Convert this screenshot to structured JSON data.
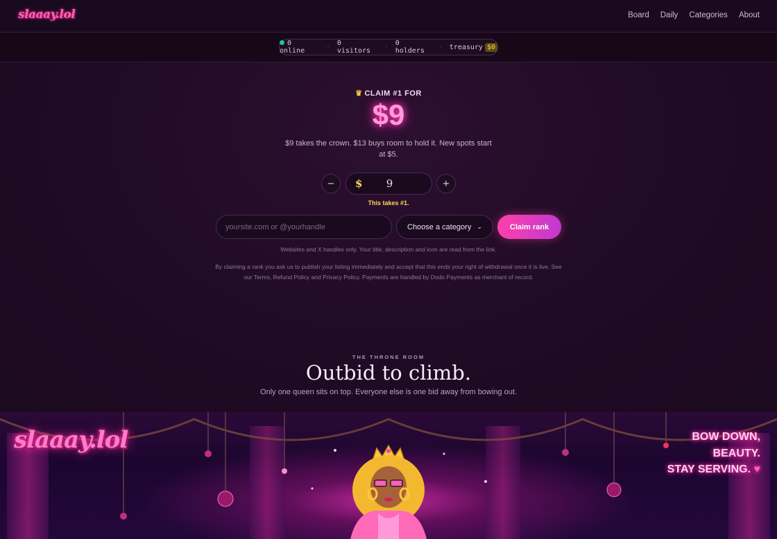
{
  "header": {
    "logo_text": "slaaay.lol",
    "nav": [
      {
        "label": "Board"
      },
      {
        "label": "Daily"
      },
      {
        "label": "Categories"
      },
      {
        "label": "About"
      }
    ]
  },
  "stats": {
    "online": "0 online",
    "visitors": "0 visitors",
    "holders": "0 holders",
    "treasury_label": "treasury",
    "treasury_value": "$0",
    "separator": "·"
  },
  "claim": {
    "label": "CLAIM #1 FOR",
    "crown_glyph": "♛",
    "price": "$9",
    "description": "$9 takes the crown. $13 buys room to hold it. New spots start at $5.",
    "minus_label": "−",
    "plus_label": "+",
    "currency": "$",
    "amount": "9",
    "takes_text": "This takes #1.",
    "url_placeholder": "yoursite.com or @yourhandle",
    "category_value": "Choose a category",
    "chevron_glyph": "⌄",
    "claim_button": "Claim rank",
    "fine_print": "Websites and X handles only. Your title, description and icon are read from the link.",
    "legal": "By claiming a rank you ask us to publish your listing immediately and accept that this ends your right of withdrawal once it is live. See our Terms, Refund Policy and Privacy Policy. Payments are handled by Dodo Payments as merchant of record."
  },
  "throne": {
    "kicker": "THE THRONE ROOM",
    "title": "Outbid to climb.",
    "subtitle": "Only one queen sits on top. Everyone else is one bid away from bowing out.",
    "scene_logo": "slaaay.lol",
    "tagline": [
      "BOW DOWN,",
      "BEAUTY.",
      "STAY SERVING."
    ],
    "heart_glyph": "♥"
  },
  "colors": {
    "accent_pink": "#ff3fa9",
    "accent_purple": "#c03ad0",
    "gold": "#ffd85a",
    "online_green": "#22c58b",
    "background": "#1c0a20"
  }
}
